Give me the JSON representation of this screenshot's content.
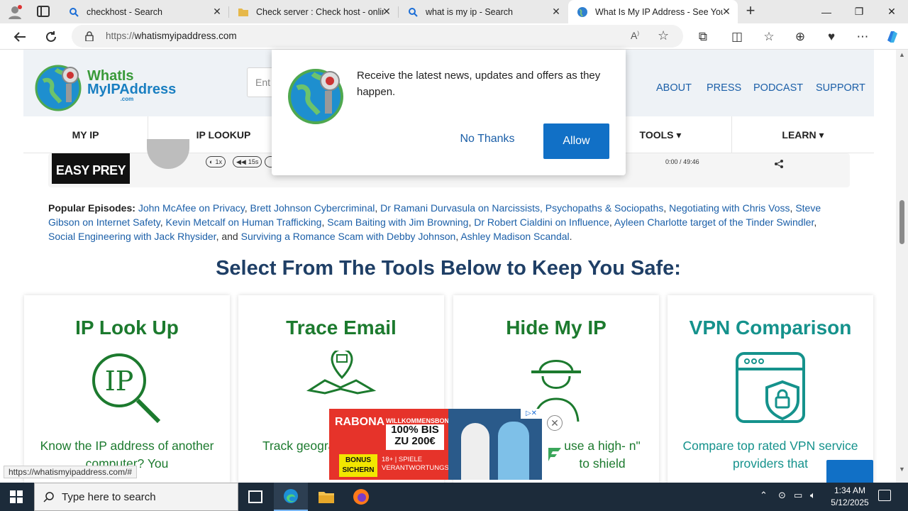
{
  "browser": {
    "tabs": [
      {
        "label": "checkhost - Search",
        "icon": "search-icon"
      },
      {
        "label": "Check server : Check host - onlin",
        "icon": "folder-icon"
      },
      {
        "label": "what is my ip - Search",
        "icon": "search-icon"
      },
      {
        "label": "What Is My IP Address - See Your",
        "icon": "globe-icon"
      }
    ],
    "url_prefix": "https://",
    "url_host": "whatismyipaddress.com"
  },
  "site": {
    "logo_line1": "WhatIs",
    "logo_line2": "MyIPAddress",
    "logo_com": ".com",
    "search_placeholder": "Ent",
    "topnav": [
      "ABOUT",
      "PRESS",
      "PODCAST",
      "SUPPORT"
    ],
    "menu": [
      "MY IP",
      "IP LOOKUP",
      "TOOLS ▾",
      "LEARN ▾"
    ]
  },
  "player": {
    "cover_text": "EASY PREY",
    "speed": "1x",
    "rewind": "15s",
    "time_current": "0:00",
    "time_separator": "/",
    "time_total": "49:46"
  },
  "episodes": {
    "label": "Popular Episodes:",
    "items": [
      "John McAfee on Privacy",
      "Brett Johnson Cybercriminal",
      "Dr Ramani Durvasula on Narcissists, Psychopaths & Sociopaths",
      "Negotiating with Chris Voss",
      "Steve Gibson on Internet Safety",
      "Kevin Metcalf on Human Trafficking",
      "Scam Baiting with Jim Browning",
      "Dr Robert Cialdini on Influence",
      "Ayleen Charlotte target of the Tinder Swindler",
      "Social Engineering with Jack Rhysider",
      "Surviving a Romance Scam with Debby Johnson",
      "Ashley Madison Scandal"
    ],
    "and_text": ", and",
    "period": "."
  },
  "headline": "Select From The Tools Below to Keep You Safe:",
  "cards": [
    {
      "title": "IP Look Up",
      "text": "Know the IP address of another computer? You",
      "color": "#1c7a2e"
    },
    {
      "title": "Trace Email",
      "text": "Track geographic origin of re",
      "color": "#1c7a2e"
    },
    {
      "title": "Hide My IP",
      "text": "use a high- n\" to shield",
      "color": "#1c7a2e"
    },
    {
      "title": "VPN Comparison",
      "text": "Compare top rated VPN service providers that",
      "color": "#15928c"
    }
  ],
  "popup": {
    "message": "Receive the latest news, updates and offers as they happen.",
    "no_thanks": "No Thanks",
    "allow": "Allow"
  },
  "ad": {
    "brand": "RABONA",
    "headline1": "WILLKOMMENSBONUS",
    "headline2": "100% BIS",
    "headline3": "ZU 200€",
    "badge1": "BONUS",
    "badge2": "SICHERN",
    "legal1": "18+ | SPIELE",
    "legal2": "VERANTWORTUNGS..."
  },
  "status_url": "https://whatismyipaddress.com/#",
  "taskbar": {
    "search_placeholder": "Type here to search",
    "time": "1:34 AM",
    "date": "5/12/2025"
  }
}
